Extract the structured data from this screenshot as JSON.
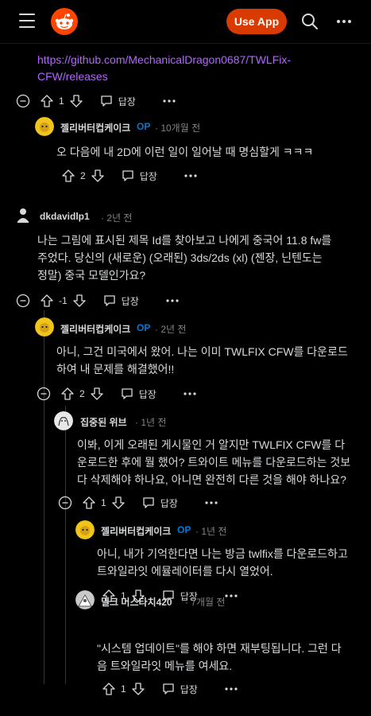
{
  "header": {
    "use_app": "Use App"
  },
  "comments": [
    {
      "text_lines": [
        "https://github.com/MechanicalDragon0687/TWLFix-",
        "CFW/releases"
      ],
      "votes": "1",
      "reply": "답장"
    },
    {
      "author": "젤리버터컵케이크",
      "op": "OP",
      "age": "· 10개월 전",
      "text_lines": [
        "오 다음에 내 2D에 이런 일이 일어날 때 명심할게 ㅋㅋㅋ"
      ],
      "votes": "2",
      "reply": "답장"
    },
    {
      "author": "dkdavidlp1",
      "age": "· 2년 전",
      "text_lines": [
        "나는 그림에 표시된 제목 Id를 찾아보고 나에게 중국어 11.8 fw를",
        "주었다. 당신의 (새로운) (오래된) 3ds/2ds (xl) (젠장, 닌텐도는",
        "정말) 중국 모델인가요?"
      ],
      "votes": "-1",
      "reply": "답장"
    },
    {
      "author": "젤리버터컵케이크",
      "op": "OP",
      "age": "· 2년 전",
      "text_lines": [
        "아니, 그건 미국에서 왔어. 나는 이미 TWLFIX CFW를 다운로드",
        "하여 내 문제를 해결했어!!"
      ],
      "votes": "2",
      "reply": "답장"
    },
    {
      "author": "집중된 위브",
      "age": "· 1년 전",
      "text_lines": [
        "이봐, 이게 오래된 게시물인 거 알지만 TWLFIX CFW를 다",
        "운로드한 후에 뭘 했어? 트와이트 메뉴를 다운로드하는 것보",
        "다 삭제해야 하나요, 아니면 완전히 다른 것을 해야 하나요?"
      ],
      "votes": "1",
      "reply": "답장"
    },
    {
      "author": "젤리버터컵케이크",
      "op": "OP",
      "age": "· 1년 전",
      "text_lines": [
        "아니, 내가 기억한다면 나는 방금 twlfix를 다운로드하고",
        "트와일라잇 에뮬레이터를 다시 열었어."
      ],
      "votes": "1",
      "reply": "답장"
    },
    {
      "author": "밀크 머스타치420",
      "age": "· 7개월 전",
      "text_lines": [
        "\"시스템 업데이트\"를 해야 하면 재부팅됩니다. 그런 다",
        "음 트와일라잇 메뉴를 여세요."
      ],
      "votes": "1",
      "reply": "답장"
    }
  ]
}
